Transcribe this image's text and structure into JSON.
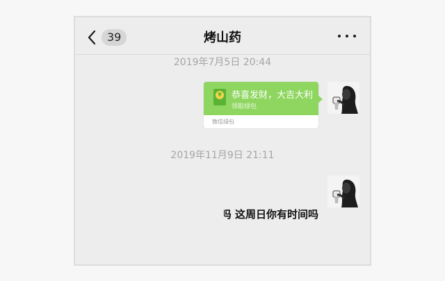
{
  "header": {
    "unread_count": "39",
    "title": "烤山药"
  },
  "messages": [
    {
      "timestamp": "2019年7月5日 20:44",
      "red_packet": {
        "greeting": "恭喜发财，大吉大利",
        "action": "领取绿包",
        "footer": "微信绿包",
        "icon_symbol": "¥"
      }
    },
    {
      "timestamp": "2019年11月9日 21:11",
      "text": "吗 这周日你有时间吗"
    }
  ],
  "colors": {
    "red_packet_green": "#8ed65f",
    "background": "#ededed",
    "timestamp_gray": "#a5a5a5"
  },
  "icons": [
    "back-chevron-icon",
    "more-dots-icon",
    "red-packet-icon",
    "avatar-icon"
  ]
}
